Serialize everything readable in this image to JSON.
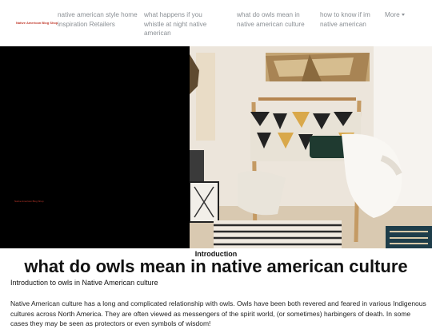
{
  "navbar": {
    "brand": "Native American Blog Shop",
    "links": [
      "native american style home inspiration Retailers",
      "what happens if you whistle at night native american",
      "what do owls mean in native american culture",
      "how to know if im native american"
    ],
    "more_label": "More"
  },
  "hero": {
    "small_text": "Native American Blog Shop"
  },
  "article": {
    "intro_label": "Introduction",
    "title": "what do owls mean in native american culture",
    "subheading": "Introduction to owls in Native American culture",
    "body": "Native American culture has a long and complicated relationship with owls. Owls have been both revered and feared in various Indigenous cultures across North America. They are often viewed as messengers of the spirit world, (or sometimes) harbingers of death. In some cases they may be seen as protectors or even symbols of wisdom!"
  }
}
